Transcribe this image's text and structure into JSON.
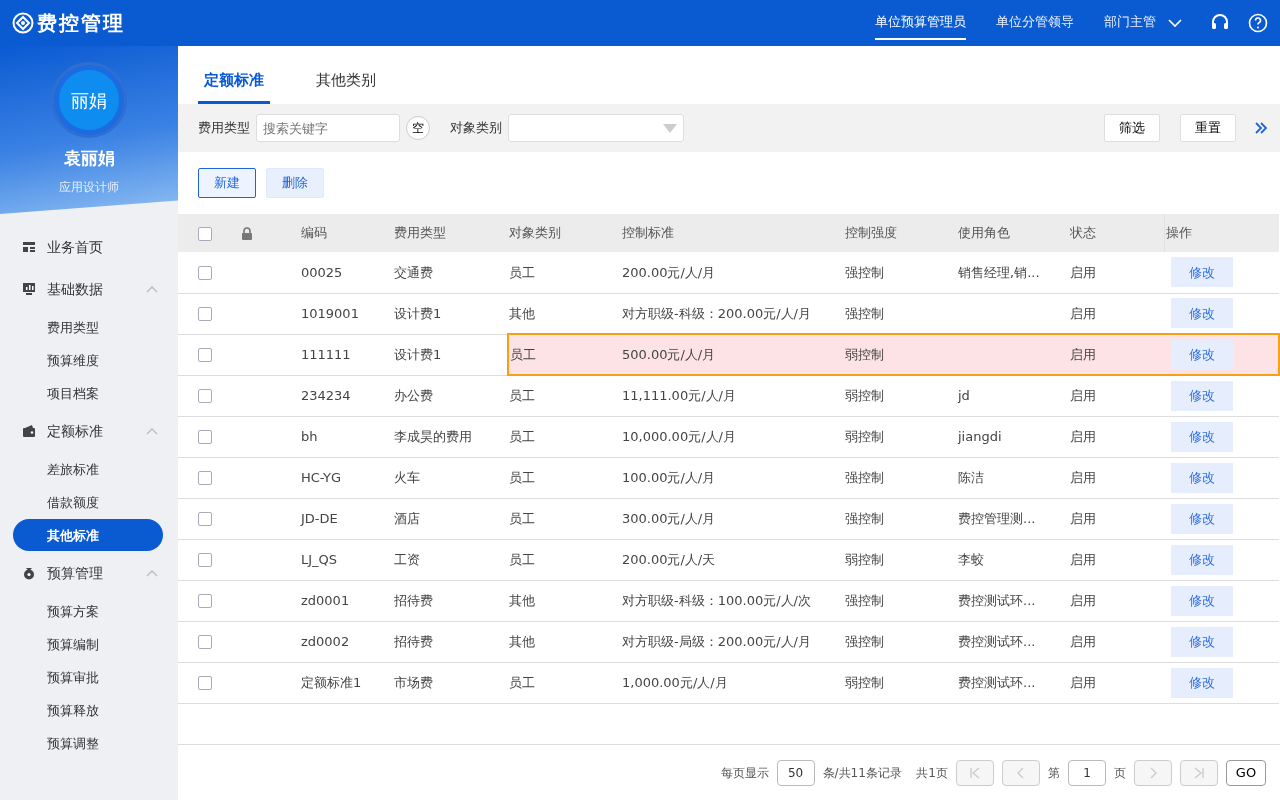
{
  "app": {
    "title": "费控管理"
  },
  "top_nav": {
    "roles": [
      {
        "label": "单位预算管理员",
        "selected": true
      },
      {
        "label": "单位分管领导",
        "selected": false
      },
      {
        "label": "部门主管",
        "selected": false
      }
    ]
  },
  "user": {
    "avatar_text": "丽娟",
    "name": "袁丽娟",
    "role": "应用设计师"
  },
  "sidebar": {
    "items": [
      {
        "label": "业务首页",
        "kind": "link",
        "selected": false
      },
      {
        "label": "基础数据",
        "kind": "group",
        "expanded": true,
        "children": [
          {
            "label": "费用类型",
            "selected": false
          },
          {
            "label": "预算维度",
            "selected": false
          },
          {
            "label": "项目档案",
            "selected": false
          }
        ]
      },
      {
        "label": "定额标准",
        "kind": "group",
        "expanded": true,
        "children": [
          {
            "label": "差旅标准",
            "selected": false
          },
          {
            "label": "借款额度",
            "selected": false
          },
          {
            "label": "其他标准",
            "selected": true
          }
        ]
      },
      {
        "label": "预算管理",
        "kind": "group",
        "expanded": true,
        "children": [
          {
            "label": "预算方案",
            "selected": false
          },
          {
            "label": "预算编制",
            "selected": false
          },
          {
            "label": "预算审批",
            "selected": false
          },
          {
            "label": "预算释放",
            "selected": false
          },
          {
            "label": "预算调整",
            "selected": false
          }
        ]
      }
    ]
  },
  "tabs": [
    {
      "label": "定额标准",
      "selected": true
    },
    {
      "label": "其他类别",
      "selected": false
    }
  ],
  "filters": {
    "expense_type_label": "费用类型",
    "expense_type_placeholder": "搜索关键字",
    "clear_button": "空",
    "object_type_label": "对象类别",
    "filter_button": "筛选",
    "reset_button": "重置"
  },
  "actions": [
    {
      "label": "新建",
      "kind": "primary"
    },
    {
      "label": "删除",
      "kind": "secondary"
    }
  ],
  "table": {
    "all_checked": false,
    "columns": [
      "编码",
      "费用类型",
      "对象类别",
      "控制标准",
      "控制强度",
      "使用角色",
      "状态",
      "操作"
    ],
    "rows": [
      {
        "checked": false,
        "highlighted": false,
        "cells": [
          "00025",
          "交通费",
          "员工",
          "200.00元/人/月",
          "强控制",
          "销售经理,销...",
          "启用"
        ],
        "action": "修改"
      },
      {
        "checked": false,
        "highlighted": false,
        "cells": [
          "1019001",
          "设计费1",
          "其他",
          "对方职级-科级：200.00元/人/月",
          "强控制",
          "",
          "启用"
        ],
        "action": "修改"
      },
      {
        "checked": false,
        "highlighted": true,
        "cells": [
          "111111",
          "设计费1",
          "员工",
          "500.00元/人/月",
          "弱控制",
          "",
          "启用"
        ],
        "action": "修改"
      },
      {
        "checked": false,
        "highlighted": false,
        "cells": [
          "234234",
          "办公费",
          "员工",
          "11,111.00元/人/月",
          "弱控制",
          "jd",
          "启用"
        ],
        "action": "修改"
      },
      {
        "checked": false,
        "highlighted": false,
        "cells": [
          "bh",
          "李成昊的费用",
          "员工",
          "10,000.00元/人/月",
          "弱控制",
          "jiangdi",
          "启用"
        ],
        "action": "修改"
      },
      {
        "checked": false,
        "highlighted": false,
        "cells": [
          "HC-YG",
          "火车",
          "员工",
          "100.00元/人/月",
          "强控制",
          "陈洁",
          "启用"
        ],
        "action": "修改"
      },
      {
        "checked": false,
        "highlighted": false,
        "cells": [
          "JD-DE",
          "酒店",
          "员工",
          "300.00元/人/月",
          "强控制",
          "费控管理测...",
          "启用"
        ],
        "action": "修改"
      },
      {
        "checked": false,
        "highlighted": false,
        "cells": [
          "LJ_QS",
          "工资",
          "员工",
          "200.00元/人/天",
          "弱控制",
          "李蛟",
          "启用"
        ],
        "action": "修改"
      },
      {
        "checked": false,
        "highlighted": false,
        "cells": [
          "zd0001",
          "招待费",
          "其他",
          "对方职级-科级：100.00元/人/次",
          "强控制",
          "费控测试环...",
          "启用"
        ],
        "action": "修改"
      },
      {
        "checked": false,
        "highlighted": false,
        "cells": [
          "zd0002",
          "招待费",
          "其他",
          "对方职级-局级：200.00元/人/月",
          "强控制",
          "费控测试环...",
          "启用"
        ],
        "action": "修改"
      },
      {
        "checked": false,
        "highlighted": false,
        "cells": [
          "定额标准1",
          "市场费",
          "员工",
          "1,000.00元/人/月",
          "弱控制",
          "费控测试环...",
          "启用"
        ],
        "action": "修改"
      }
    ]
  },
  "pagination": {
    "per_page_label": "每页显示",
    "per_page": "50",
    "records": "条/共11条记录",
    "pages": "共1页",
    "page_prefix": "第",
    "page": "1",
    "page_suffix": "页",
    "go": "GO",
    "first_disabled": true,
    "prev_disabled": true,
    "next_disabled": true,
    "last_disabled": true
  }
}
